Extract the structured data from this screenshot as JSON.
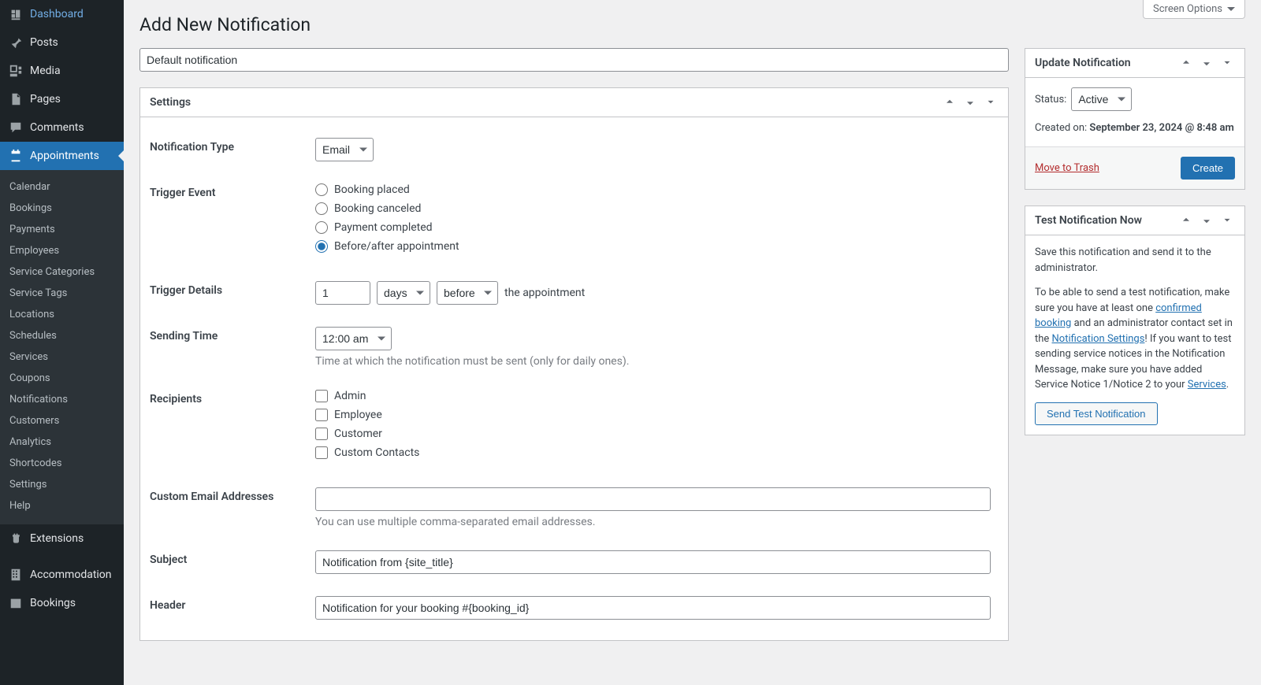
{
  "screen_options": "Screen Options",
  "page_title": "Add New Notification",
  "title_value": "Default notification",
  "sidebar": {
    "top": [
      {
        "icon": "dashboard",
        "label": "Dashboard"
      },
      {
        "icon": "pin",
        "label": "Posts"
      },
      {
        "icon": "media",
        "label": "Media"
      },
      {
        "icon": "page",
        "label": "Pages"
      },
      {
        "icon": "comment",
        "label": "Comments"
      },
      {
        "icon": "calendar",
        "label": "Appointments",
        "active": true
      }
    ],
    "sub": [
      "Calendar",
      "Bookings",
      "Payments",
      "Employees",
      "Service Categories",
      "Service Tags",
      "Locations",
      "Schedules",
      "Services",
      "Coupons",
      "Notifications",
      "Customers",
      "Analytics",
      "Shortcodes",
      "Settings",
      "Help"
    ],
    "extensions": "Extensions",
    "bottom": [
      {
        "icon": "building",
        "label": "Accommodation"
      },
      {
        "icon": "calgrid",
        "label": "Bookings"
      }
    ]
  },
  "settings_panel": {
    "title": "Settings",
    "fields": {
      "notif_type_label": "Notification Type",
      "notif_type_value": "Email",
      "trigger_event_label": "Trigger Event",
      "trigger_options": [
        "Booking placed",
        "Booking canceled",
        "Payment completed",
        "Before/after appointment"
      ],
      "trigger_selected_index": 3,
      "trigger_details_label": "Trigger Details",
      "trigger_num": "1",
      "trigger_unit": "days",
      "trigger_when": "before",
      "trigger_tail": "the appointment",
      "sending_time_label": "Sending Time",
      "sending_time_value": "12:00 am",
      "sending_time_desc": "Time at which the notification must be sent (only for daily ones).",
      "recipients_label": "Recipients",
      "recipients": [
        "Admin",
        "Employee",
        "Customer",
        "Custom Contacts"
      ],
      "custom_emails_label": "Custom Email Addresses",
      "custom_emails_value": "",
      "custom_emails_desc": "You can use multiple comma-separated email addresses.",
      "subject_label": "Subject",
      "subject_value": "Notification from {site_title}",
      "header_label": "Header",
      "header_value": "Notification for your booking #{booking_id}"
    }
  },
  "update_box": {
    "title": "Update Notification",
    "status_label": "Status:",
    "status_value": "Active",
    "created_label": "Created on:",
    "created_value": "September 23, 2024 @ 8:48 am",
    "trash": "Move to Trash",
    "submit": "Create"
  },
  "test_box": {
    "title": "Test Notification Now",
    "p1": "Save this notification and send it to the administrator.",
    "p2a": "To be able to send a test notification, make sure you have at least one ",
    "link1": "confirmed booking",
    "p2b": " and an administrator contact set in the ",
    "link2": "Notification Settings",
    "p2c": "! If you want to test sending service notices in the Notification Message, make sure you have added Service Notice 1/Notice 2 to your ",
    "link3": "Services",
    "p2d": ".",
    "button": "Send Test Notification"
  }
}
